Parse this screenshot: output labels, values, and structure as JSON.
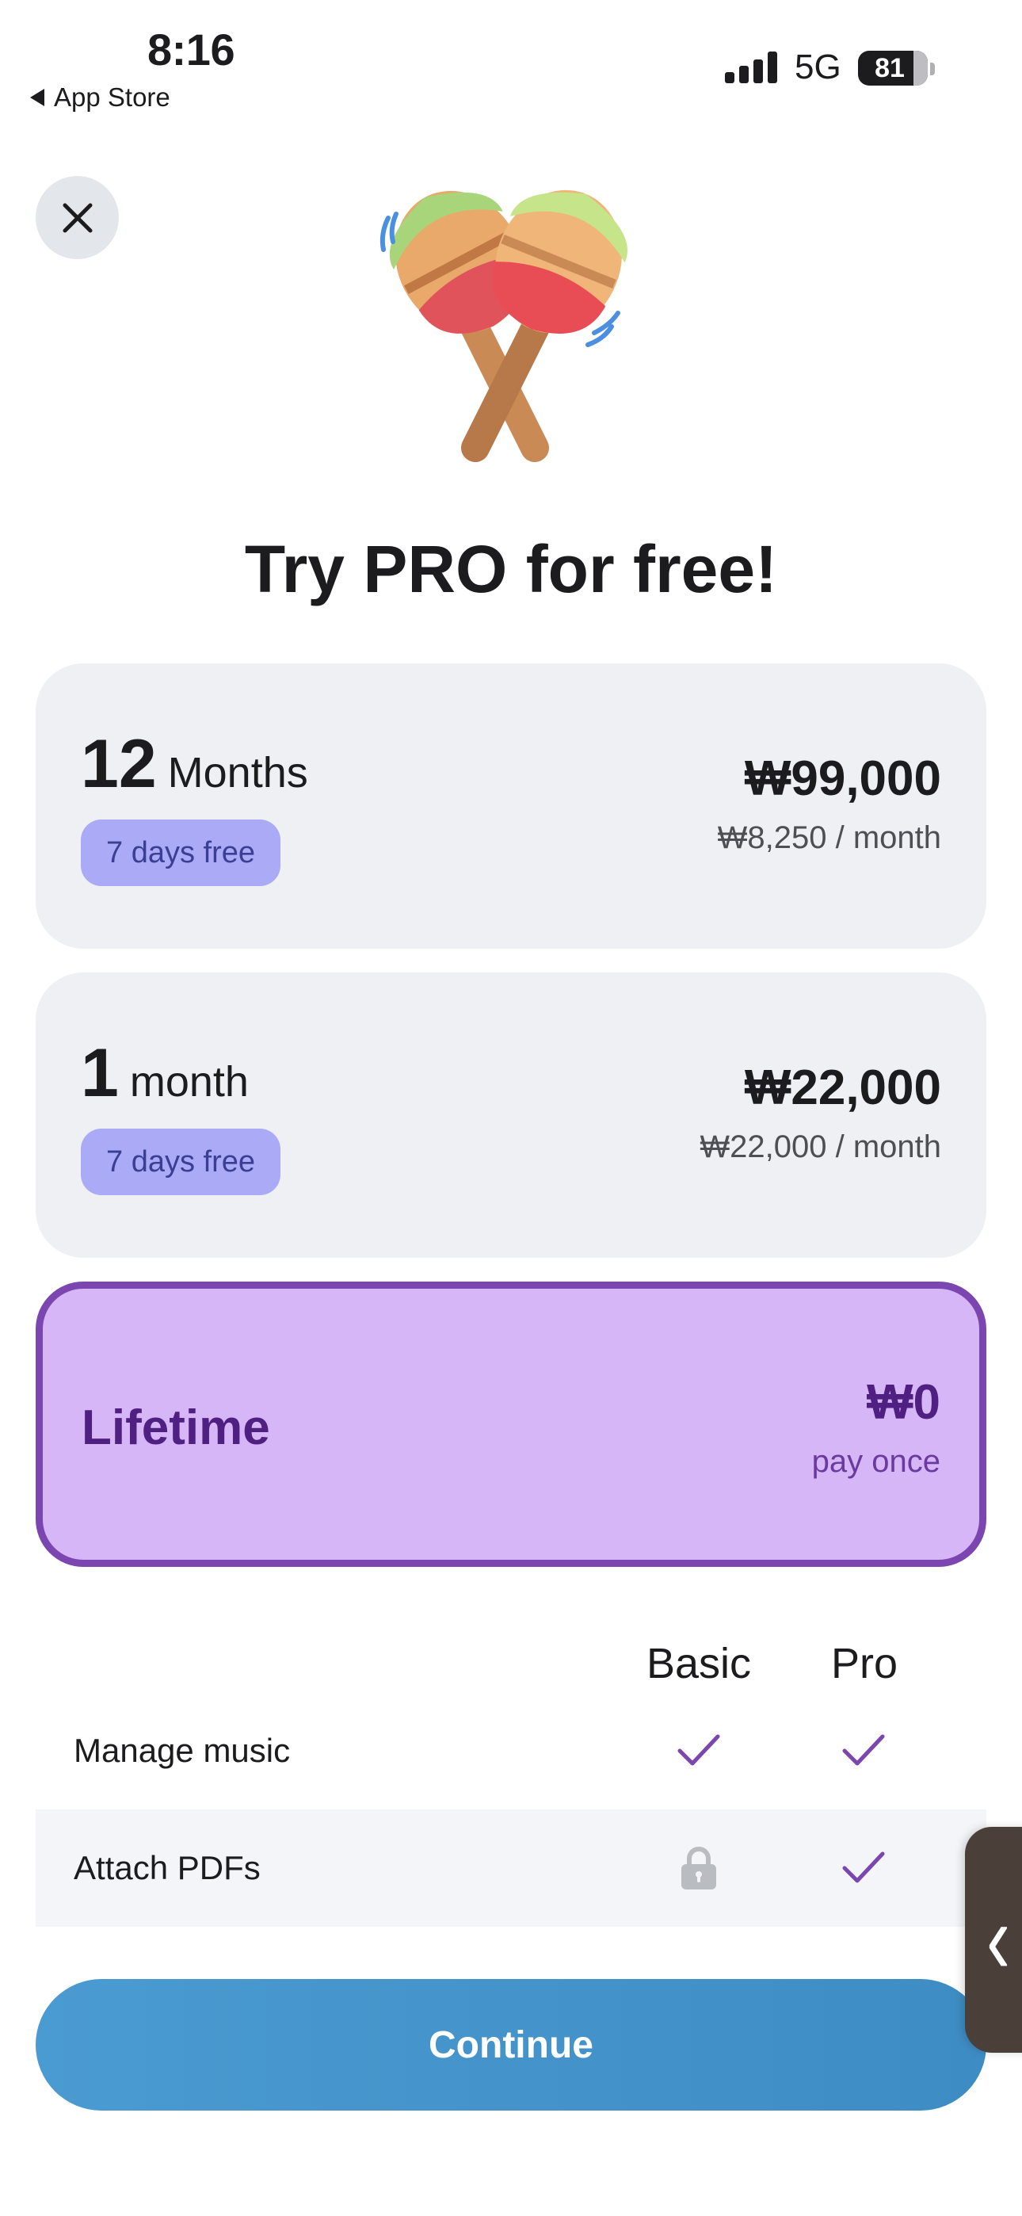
{
  "status_bar": {
    "time": "8:16",
    "back_label": "App Store",
    "network": "5G",
    "battery": "81"
  },
  "close_icon": "close-icon",
  "hero_icon": "maracas-icon",
  "headline": "Try PRO for free!",
  "plans": [
    {
      "number": "12",
      "unit": "Months",
      "badge": "7 days free",
      "price": "₩99,000",
      "subtext": "₩8,250 / month"
    },
    {
      "number": "1",
      "unit": "month",
      "badge": "7 days free",
      "price": "₩22,000",
      "subtext": "₩22,000 / month"
    },
    {
      "title": "Lifetime",
      "price": "₩0",
      "subtext": "pay once",
      "selected": true
    }
  ],
  "comparison": {
    "columns": [
      "Basic",
      "Pro"
    ],
    "rows": [
      {
        "feature": "Manage music",
        "basic": "check-icon",
        "pro": "check-icon"
      },
      {
        "feature": "Attach PDFs",
        "basic": "lock-icon",
        "pro": "check-icon"
      }
    ]
  },
  "continue_label": "Continue",
  "colors": {
    "card_bg": "#eef0f4",
    "badge_bg": "#aaaaf7",
    "selected_bg": "#d7b6f8",
    "selected_border": "#7b46b0",
    "check": "#7b46b0",
    "continue_bg": "#4596cc"
  }
}
